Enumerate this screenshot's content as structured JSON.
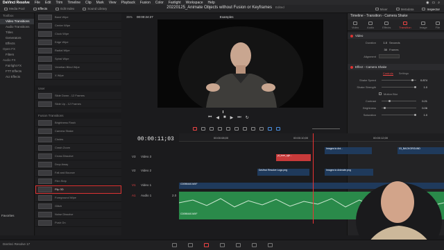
{
  "menubar": {
    "app": "DaVinci Resolve",
    "items": [
      "File",
      "Edit",
      "Trim",
      "Timeline",
      "Clip",
      "Mark",
      "View",
      "Playback",
      "Fusion",
      "Color",
      "Fairlight",
      "Workspace",
      "Help"
    ]
  },
  "toolbar": {
    "left_tabs": [
      "Media Pool",
      "Effects",
      "Edit Index",
      "Sound Library"
    ],
    "project_title": "20220125_Animate Objects without Fusion or Keyframes",
    "project_status": "Edited",
    "right_tabs": [
      "Mixer",
      "Metadata",
      "Inspector"
    ]
  },
  "tree": {
    "sections": [
      {
        "title": "Toolbox",
        "items": [
          "Video Transitions",
          "Audio Transitions",
          "Titles",
          "Generators",
          "Effects"
        ]
      },
      {
        "title": "Open FX",
        "items": [
          "Filters"
        ]
      },
      {
        "title": "Audio FX",
        "items": [
          "Fairlight FX",
          "FTT Effects",
          "AU Effects"
        ]
      }
    ],
    "selected": "Video Transitions"
  },
  "fxlist": {
    "top_items": [
      "Band Wipe",
      "Center Wipe",
      "Clock Wipe",
      "Edge Wipe",
      "Radial Wipe",
      "Spiral Wipe",
      "Venetian Blind Wipe",
      "X Wipe"
    ],
    "user_cat": "User",
    "user_items": [
      "Slide Down - 12 Frames",
      "Slide Up - 12 Frames"
    ],
    "fusion_cat": "Fusion Transitions",
    "fusion_items": [
      "Brightness Flash",
      "Camera Shake",
      "Circles",
      "Crash Zoom",
      "Cross Dissolve",
      "Drop Away",
      "Fall and Bounce",
      "Film Strip",
      "Flip 3D",
      "Foreground Wipe",
      "Glitch",
      "Noise Dissolve",
      "Push On"
    ],
    "selected": "Flip 3D",
    "favorites": "Favorites"
  },
  "viewer": {
    "zoom": "35%",
    "timecode": "00:00:24:27",
    "clip_name": "Examples"
  },
  "inspector": {
    "title": "Timeline - Transition - Camera Shake",
    "tabs": [
      "Video",
      "Audio",
      "Effects",
      "Transition",
      "Image",
      "File"
    ],
    "active_tab": "Transition",
    "video_section": "Video",
    "duration_label": "Duration",
    "duration_value": "1.0",
    "duration_unit": "Seconds",
    "frames_value": "30",
    "frames_unit": "Frames",
    "alignment_label": "Alignment",
    "effect_section": "Effect - Camera Shake",
    "subtabs": [
      "Controls",
      "Settings"
    ],
    "shake_speed_label": "Shake Speed",
    "shake_speed": "0.874",
    "shake_strength_label": "Shake Strength",
    "shake_strength": "1.0",
    "motion_blur": "Motion Blur",
    "contrast_label": "Contrast",
    "contrast": "0.21",
    "brightness_label": "Brightness",
    "brightness": "0.06",
    "saturation_label": "Saturation",
    "saturation": "1.0"
  },
  "timeline": {
    "timecode": "00:00:11;03",
    "ruler": [
      "00:00:08;00",
      "00:00:10;00",
      "00:00:12;00"
    ],
    "tracks": [
      {
        "id": "V3",
        "name": "Video 3"
      },
      {
        "id": "V2",
        "name": "Video 2"
      },
      {
        "id": "V1",
        "name": "Video 1"
      },
      {
        "id": "A1",
        "name": "Audio 1",
        "level": "2.0"
      }
    ],
    "clips": {
      "v3": [
        "Images to Ani...",
        "03_BACKGROUND"
      ],
      "v2a": [
        "yt_icon_rgb..."
      ],
      "v2b": [
        "DaVinci Resolve Logo.png",
        "Images to Animate.png"
      ],
      "v2c": [
        "Images to Animate.png"
      ],
      "v1": [
        "C0098440.MXF"
      ],
      "a1": [
        "C0098440.MXF"
      ]
    }
  },
  "footer": {
    "app_version": "DaVinci Resolve 17"
  }
}
